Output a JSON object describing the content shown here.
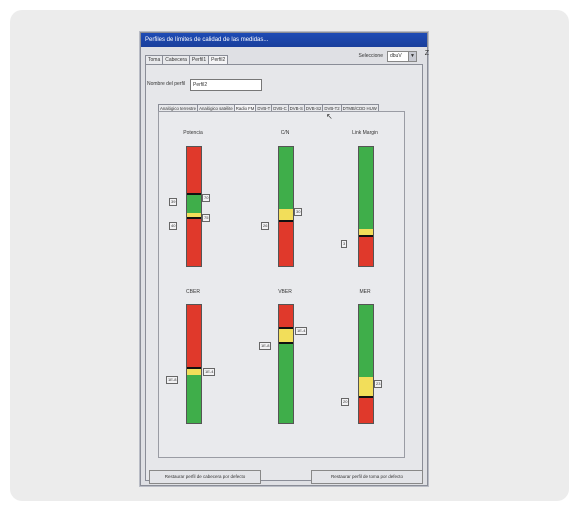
{
  "window": {
    "title": "Perfiles de límites de calidad de las medidas..."
  },
  "selector": {
    "label": "Seleccione",
    "value": "dbuV",
    "edge_glyph": "Z"
  },
  "top_tabs": [
    "Toma",
    "Cabecera",
    "Perfil1",
    "Perfil2"
  ],
  "profile": {
    "name_label": "Nombre del perfil",
    "name_value": "Perfil2"
  },
  "sub_tabs": [
    "Analógico terrestre",
    "Analógico satélite",
    "Radio FM",
    "DVB-T",
    "DVB-C",
    "DVB-S",
    "DVB-S2",
    "DVB-T2",
    "DTMB/CDD HUW"
  ],
  "meters": [
    {
      "label": "Potencia",
      "values": [
        "39",
        "70",
        "40",
        "75"
      ]
    },
    {
      "label": "C/N",
      "values": [
        "26",
        "30"
      ]
    },
    {
      "label": "Link Margin",
      "values": [
        "3"
      ]
    },
    {
      "label": "CBER",
      "values": [
        "1E-8",
        "1E-4"
      ]
    },
    {
      "label": "VBER",
      "values": [
        "1E-8",
        "1E-4"
      ]
    },
    {
      "label": "MER",
      "values": [
        "20",
        "23"
      ]
    }
  ],
  "buttons": {
    "restore_header": "Restaurar perfil de cabecera por defecto",
    "restore_toma": "Restaurar perfil de toma por defecto"
  },
  "colors": {
    "red": "#e0392b",
    "green": "#3fae4a",
    "yellow": "#f2de5a",
    "titlebar": "#1e4bb5"
  }
}
